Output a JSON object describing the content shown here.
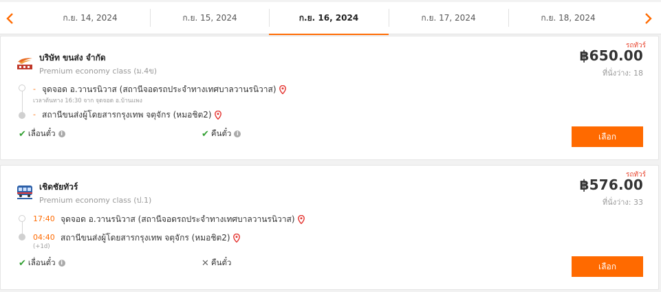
{
  "dates": {
    "tabs": [
      "ก.ย. 14, 2024",
      "ก.ย. 15, 2024",
      "ก.ย. 16, 2024",
      "ก.ย. 17, 2024",
      "ก.ย. 18, 2024"
    ],
    "active_index": 2
  },
  "trips": [
    {
      "tag": "รถทัวร์",
      "price": "฿650.00",
      "seats": "ที่นั่งว่าง: 18",
      "company": "บริษัท ขนส่ง จำกัด",
      "bus_class": "Premium economy class (ม.4ข)",
      "depart": {
        "time": "-",
        "stop": "จุดจอด อ.วานรนิวาส (สถานีจอดรถประจำทางเทศบาลวานรนิวาส)",
        "note": "เวลาต้นทาง 16:30   จาก จุดจอด อ.บ้านแพง"
      },
      "arrive": {
        "time": "-",
        "stop": "สถานีขนส่งผู้โดยสารกรุงเทพ จตุจักร (หมอชิต2)",
        "note": ""
      },
      "policies": {
        "change_label": "เลื่อนตั๋ว",
        "refund_label": "คืนตั๋ว"
      },
      "button": "เลือก"
    },
    {
      "tag": "รถทัวร์",
      "price": "฿576.00",
      "seats": "ที่นั่งว่าง: 33",
      "company": "เชิดชัยทัวร์",
      "bus_class": "Premium economy class (ป.1)",
      "depart": {
        "time": "17:40",
        "stop": "จุดจอด อ.วานรนิวาส (สถานีจอดรถประจำทางเทศบาลวานรนิวาส)",
        "note": ""
      },
      "arrive": {
        "time": "04:40",
        "stop": "สถานีขนส่งผู้โดยสารกรุงเทพ จตุจักร (หมอชิต2)",
        "note": "(+1d)"
      },
      "policies": {
        "change_label": "เลื่อนตั๋ว",
        "refund_label": "คืนตั๋ว"
      },
      "button": "เลือก"
    }
  ]
}
